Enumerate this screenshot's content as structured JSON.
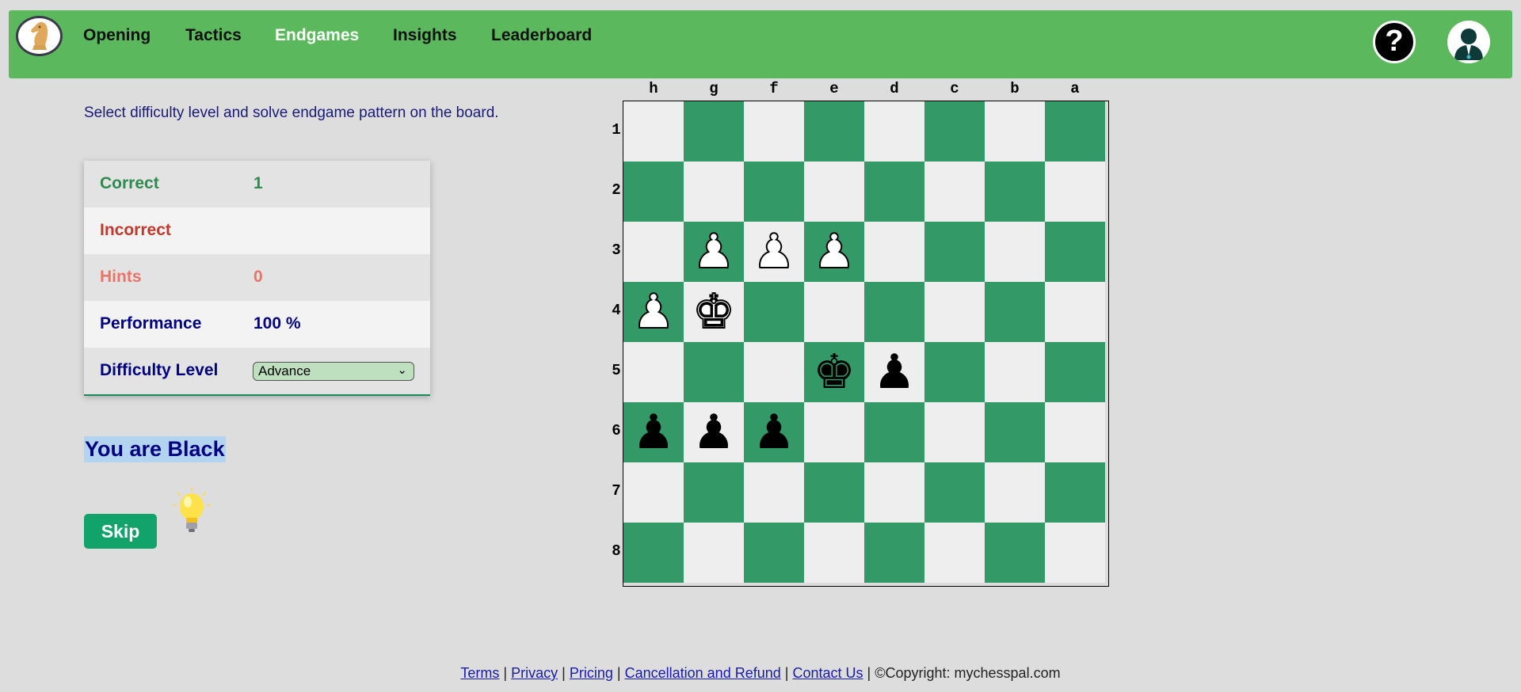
{
  "nav": {
    "items": [
      {
        "label": "Opening",
        "active": false
      },
      {
        "label": "Tactics",
        "active": false
      },
      {
        "label": "Endgames",
        "active": true
      },
      {
        "label": "Insights",
        "active": false
      },
      {
        "label": "Leaderboard",
        "active": false
      }
    ],
    "help_label": "?"
  },
  "instruction": "Select difficulty level and solve endgame pattern on the board.",
  "stats": {
    "correct_label": "Correct",
    "correct_value": "1",
    "incorrect_label": "Incorrect",
    "incorrect_value": "",
    "hints_label": "Hints",
    "hints_value": "0",
    "performance_label": "Performance",
    "performance_value": "100 %",
    "difficulty_label": "Difficulty Level",
    "difficulty_value": "Advance"
  },
  "side_text": "You are Black",
  "skip_label": "Skip",
  "board": {
    "files": [
      "h",
      "g",
      "f",
      "e",
      "d",
      "c",
      "b",
      "a"
    ],
    "ranks": [
      "1",
      "2",
      "3",
      "4",
      "5",
      "6",
      "7",
      "8"
    ],
    "pieces": [
      {
        "square": "g3",
        "color": "white",
        "type": "pawn"
      },
      {
        "square": "f3",
        "color": "white",
        "type": "pawn"
      },
      {
        "square": "e3",
        "color": "white",
        "type": "pawn"
      },
      {
        "square": "h4",
        "color": "white",
        "type": "pawn"
      },
      {
        "square": "g4",
        "color": "white",
        "type": "king"
      },
      {
        "square": "e5",
        "color": "black",
        "type": "king"
      },
      {
        "square": "d5",
        "color": "black",
        "type": "pawn"
      },
      {
        "square": "h6",
        "color": "black",
        "type": "pawn"
      },
      {
        "square": "g6",
        "color": "black",
        "type": "pawn"
      },
      {
        "square": "f6",
        "color": "black",
        "type": "pawn"
      }
    ],
    "light_color": "#eeeeee",
    "dark_color": "#339966"
  },
  "footer": {
    "links": [
      "Terms",
      "Privacy",
      "Pricing",
      "Cancellation and Refund",
      "Contact Us"
    ],
    "sep": "|",
    "copyright": "©Copyright: mychesspal.com"
  },
  "colors": {
    "navbar": "#5cb85c",
    "correct": "#2e8b4e",
    "incorrect": "#c0392b",
    "hints": "#e8746a",
    "primary_text": "#000080",
    "skip_button": "#12a36a"
  }
}
